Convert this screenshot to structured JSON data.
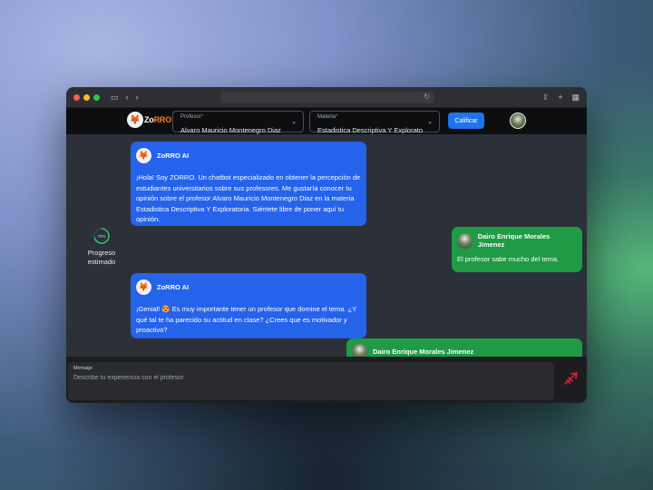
{
  "browser": {
    "toolbar_icons": [
      "sidebar-icon",
      "back-icon",
      "forward-icon",
      "reload-icon",
      "share-icon",
      "new-tab-icon",
      "tab-overview-icon"
    ]
  },
  "header": {
    "logo_text": "ZoRRO",
    "professor_label": "Profesor",
    "professor_value": "Alvaro Mauricio Montenegro Diaz",
    "subject_label": "Materia",
    "subject_value": "Estadistica Descriptiva Y Explorato",
    "rate_button": "Calificar"
  },
  "progress": {
    "percent": 70,
    "percent_text": "70%",
    "label": "Progreso estimado"
  },
  "messages": [
    {
      "sender": "ZoRRO AI",
      "type": "ai",
      "text": "¡Hola! Soy ZORRO. Un chatbot especializado en obtener la percepción de estudiantes universitarios sobre sus profesores. Me gustaría conocer tu opinión sobre el profesor Alvaro Mauricio Montenegro Diaz en la materia Estadistica Descriptiva Y Exploratoria. Siéntete libre de poner aquí tu opinión."
    },
    {
      "sender": "Dairo Enrique Morales Jimenez",
      "type": "user",
      "text": "El profesor sabe mucho del tema."
    },
    {
      "sender": "ZoRRO AI",
      "type": "ai",
      "text": "¡Genial! 😍 Es muy importante tener un profesor que domine el tema. ¿Y qué tal te ha parecido su actitud en clase? ¿Crees que es motivador y proactivo?"
    },
    {
      "sender": "Dairo Enrique Morales Jimenez",
      "type": "user",
      "text": ""
    }
  ],
  "composer": {
    "label": "Mensaje",
    "placeholder": "Describe tu experiencia con el profesor",
    "send_icon": "send-icon"
  },
  "colors": {
    "ai_bubble": "#2563eb",
    "user_bubble": "#1f9a45",
    "accent_button": "#1e74ea",
    "send_icon": "#e11d2e"
  }
}
